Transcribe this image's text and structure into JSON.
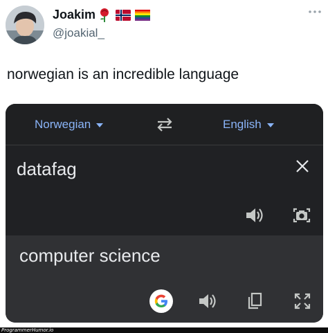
{
  "tweet": {
    "display_name": "Joakim",
    "badges": [
      "rose-icon",
      "norway-flag-icon",
      "rainbow-flag-icon"
    ],
    "handle": "@joakial_",
    "more_icon": "more-dots-icon",
    "text": "norwegian is an incredible language"
  },
  "translate": {
    "source_language": "Norwegian",
    "target_language": "English",
    "swap_icon": "swap-arrows-icon",
    "input_text": "datafag",
    "output_text": "computer science",
    "input_icons": [
      "clear-icon",
      "speaker-icon",
      "camera-icon"
    ],
    "output_icons": [
      "google-logo-icon",
      "speaker-icon",
      "copy-icon",
      "fullscreen-icon"
    ],
    "colors": {
      "card_bg": "#1f2022",
      "output_bg": "#303134",
      "accent": "#8ab4f8",
      "text": "#e8eaed"
    }
  },
  "watermark": "ProgrammerHumor.io"
}
